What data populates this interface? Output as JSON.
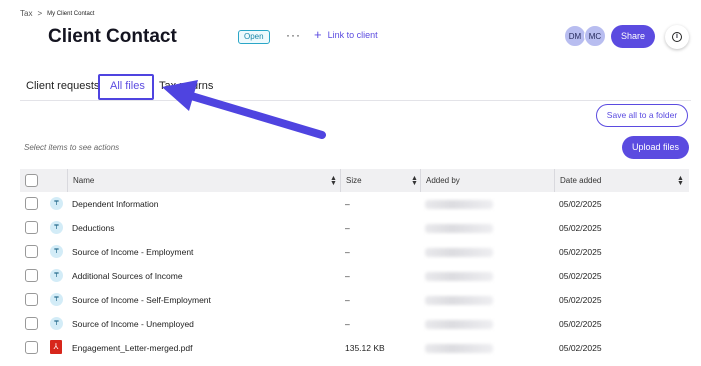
{
  "breadcrumb": {
    "parent": "Tax",
    "separator": ">",
    "current": "My Client Contact"
  },
  "header": {
    "title": "Client Contact",
    "status": "Open",
    "more_label": "···",
    "link_client_label": "Link to client",
    "avatars": [
      "DM",
      "MC"
    ],
    "share_label": "Share",
    "info_label": "i"
  },
  "tabs": [
    {
      "label": "Client requests"
    },
    {
      "label": "All files"
    },
    {
      "label": "Tax returns"
    }
  ],
  "actions": {
    "save_all_label": "Save all to a folder",
    "select_hint": "Select items to see actions",
    "upload_label": "Upload files"
  },
  "table": {
    "columns": {
      "name": "Name",
      "size": "Size",
      "added_by": "Added by",
      "date": "Date added"
    },
    "rows": [
      {
        "icon": "tax-file-icon",
        "name": "Dependent Information",
        "size": "–",
        "date": "05/02/2025"
      },
      {
        "icon": "tax-file-icon",
        "name": "Deductions",
        "size": "–",
        "date": "05/02/2025"
      },
      {
        "icon": "tax-file-icon",
        "name": "Source of Income - Employment",
        "size": "–",
        "date": "05/02/2025"
      },
      {
        "icon": "tax-file-icon",
        "name": "Additional Sources of Income",
        "size": "–",
        "date": "05/02/2025"
      },
      {
        "icon": "tax-file-icon",
        "name": "Source of Income - Self-Employment",
        "size": "–",
        "date": "05/02/2025"
      },
      {
        "icon": "tax-file-icon",
        "name": "Source of Income - Unemployed",
        "size": "–",
        "date": "05/02/2025"
      },
      {
        "icon": "pdf-icon",
        "name": "Engagement_Letter-merged.pdf",
        "size": "135.12 KB",
        "date": "05/02/2025"
      }
    ]
  },
  "colors": {
    "accent": "#5b4be0",
    "annotation": "#4f44e0",
    "badge": "#2aa6c7"
  }
}
